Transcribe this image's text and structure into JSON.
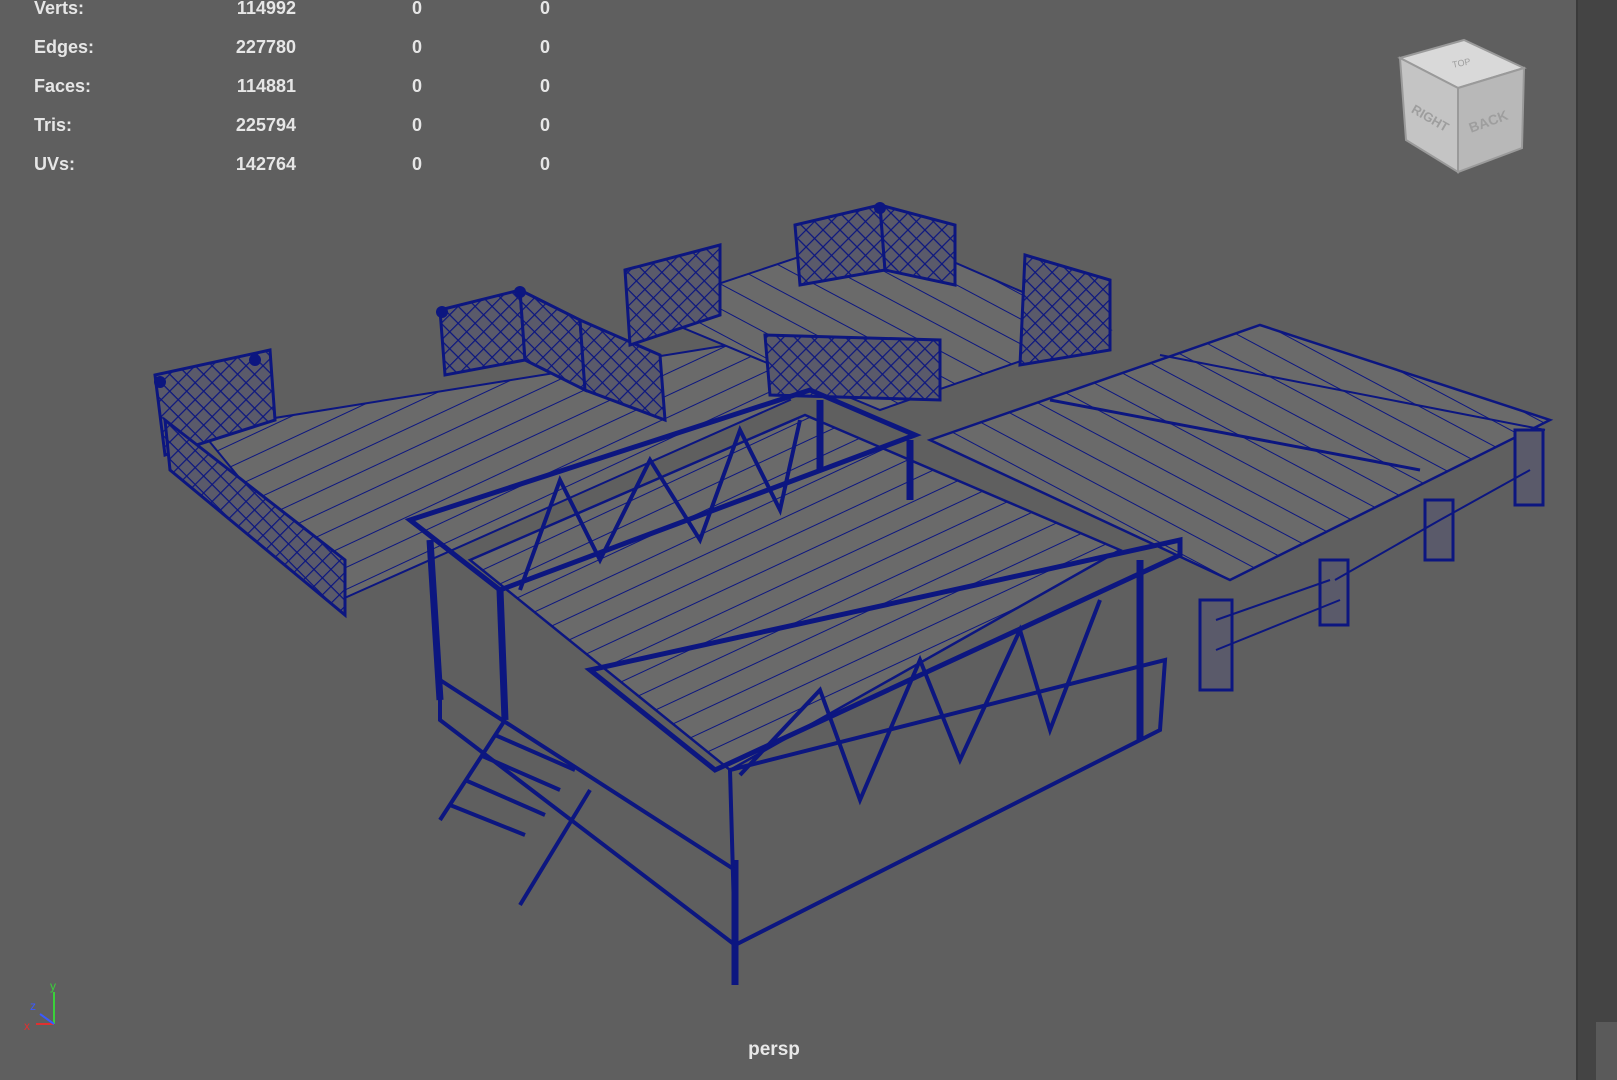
{
  "hud": {
    "rows": [
      {
        "label": "Verts:",
        "value": "114992",
        "a": "0",
        "b": "0"
      },
      {
        "label": "Edges:",
        "value": "227780",
        "a": "0",
        "b": "0"
      },
      {
        "label": "Faces:",
        "value": "114881",
        "a": "0",
        "b": "0"
      },
      {
        "label": "Tris:",
        "value": "225794",
        "a": "0",
        "b": "0"
      },
      {
        "label": "UVs:",
        "value": "142764",
        "a": "0",
        "b": "0"
      }
    ]
  },
  "viewcube": {
    "top": "TOP",
    "right": "RIGHT",
    "back": "BACK"
  },
  "axis": {
    "x": "x",
    "y": "y",
    "z": "z"
  },
  "camera": {
    "name": "persp"
  },
  "colors": {
    "background": "#5f5f5f",
    "wireframe": "#0c1680",
    "hud_text": "#e6e6e6",
    "axis_x": "#e03030",
    "axis_y": "#3ad13a",
    "axis_z": "#3a5aff"
  },
  "icons": {
    "viewcube": "view-cube-icon",
    "axis": "axis-gizmo-icon"
  }
}
